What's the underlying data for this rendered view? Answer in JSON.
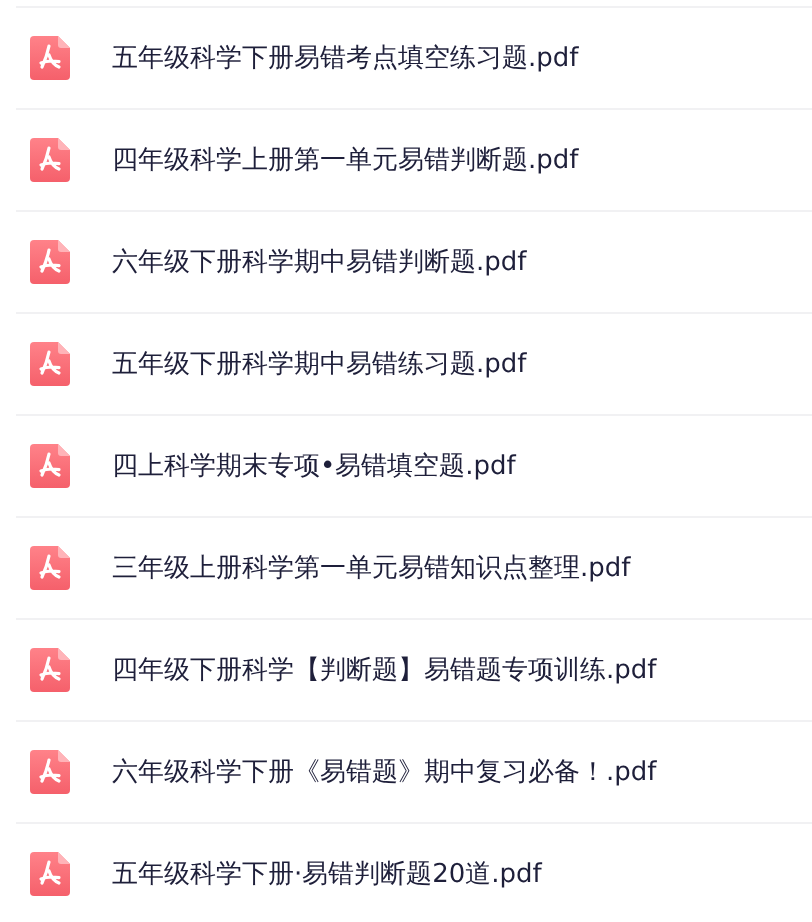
{
  "files": [
    {
      "name": "五年级科学下册易错考点填空练习题.pdf"
    },
    {
      "name": "四年级科学上册第一单元易错判断题.pdf"
    },
    {
      "name": "六年级下册科学期中易错判断题.pdf"
    },
    {
      "name": "五年级下册科学期中易错练习题.pdf"
    },
    {
      "name": "四上科学期末专项•易错填空题.pdf"
    },
    {
      "name": "三年级上册科学第一单元易错知识点整理.pdf"
    },
    {
      "name": "四年级下册科学【判断题】易错题专项训练.pdf"
    },
    {
      "name": "六年级科学下册《易错题》期中复习必备！.pdf"
    },
    {
      "name": "五年级科学下册·易错判断题20道.pdf"
    }
  ]
}
